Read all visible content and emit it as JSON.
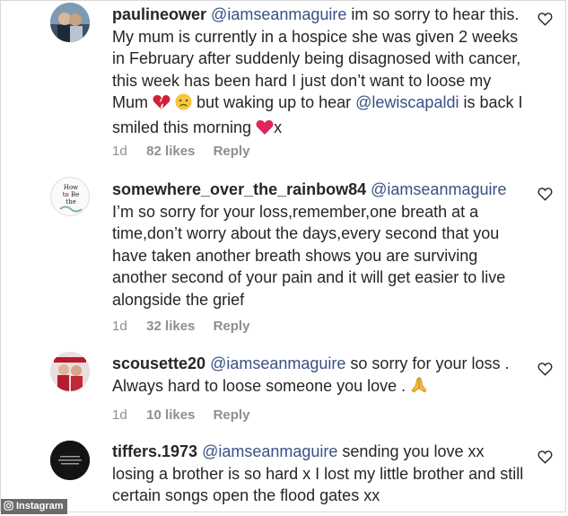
{
  "comments": [
    {
      "username": "paulineower",
      "mention": "@iamseanmaguire",
      "text": " im so sorry to hear this. My mum is currently in a hospice she was given 2 weeks in February after suddenly being disagnosed with cancer, this week has been hard I just don’t want to loose my Mum ",
      "mention2": "@lewiscapaldi",
      "text2": " but waking up to hear ",
      "text3": " is back I smiled this morning ",
      "text4": "x",
      "time": "1d",
      "likes": "82 likes",
      "reply": "Reply"
    },
    {
      "username": "somewhere_over_the_rainbow84",
      "mention": "@iamseanmaguire",
      "text": "I’m so sorry for your loss,remember,one breath at a time,don’t worry about the days,every second that you have taken another breath shows you are surviving another second of your pain and it will get easier to live alongside the grief",
      "avatar_text": "How to Be the",
      "time": "1d",
      "likes": "32 likes",
      "reply": "Reply"
    },
    {
      "username": "scousette20",
      "mention": "@iamseanmaguire",
      "text": " so sorry for your loss . Always hard to loose someone you love . ",
      "time": "1d",
      "likes": "10 likes",
      "reply": "Reply"
    },
    {
      "username": "tiffers.1973",
      "mention": "@iamseanmaguire",
      "text": " sending you love xx losing a brother is so hard x I lost my little brother and still certain songs open the flood gates xx"
    }
  ],
  "watermark": "Instagram",
  "colors": {
    "text": "#262626",
    "mention": "#385185",
    "meta": "#8e8e8e",
    "heart_red": "#e0245e"
  }
}
